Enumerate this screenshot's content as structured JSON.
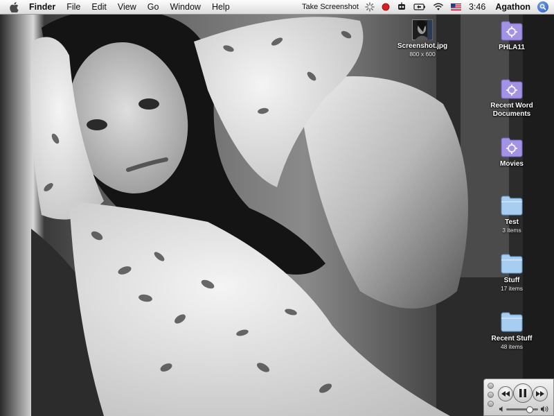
{
  "menubar": {
    "apple_icon": "apple-icon",
    "app_name": "Finder",
    "menus": [
      "File",
      "Edit",
      "View",
      "Go",
      "Window",
      "Help"
    ],
    "status": {
      "take_screenshot": "Take Screenshot",
      "icons": [
        "activity-spinner-icon",
        "record-icon",
        "robot-icon",
        "battery-icon",
        "wifi-icon",
        "us-flag-icon"
      ],
      "clock": "3:46",
      "user": "Agathon",
      "spotlight_icon": "spotlight-icon"
    }
  },
  "desktop": {
    "screenshot_file": {
      "name": "Screenshot.jpg",
      "dims": "800 x 600"
    },
    "items": [
      {
        "name": "PHLA11",
        "subtitle": "",
        "type": "smart-folder"
      },
      {
        "name": "Recent Word Documents",
        "subtitle": "",
        "type": "smart-folder"
      },
      {
        "name": "Movies",
        "subtitle": "",
        "type": "smart-folder"
      },
      {
        "name": "Test",
        "subtitle": "3 items",
        "type": "folder"
      },
      {
        "name": "Stuff",
        "subtitle": "17 items",
        "type": "folder"
      },
      {
        "name": "Recent Stuff",
        "subtitle": "48 items",
        "type": "folder"
      }
    ]
  },
  "itunes": {
    "controls": [
      "rewind-icon",
      "pause-icon",
      "fast-forward-icon"
    ],
    "volume": 0.72
  },
  "colors": {
    "menubar": "#e9e9e9",
    "smart_folder": "#9d8ee0",
    "folder": "#9cc3e8",
    "spotlight": "#2456b5"
  }
}
